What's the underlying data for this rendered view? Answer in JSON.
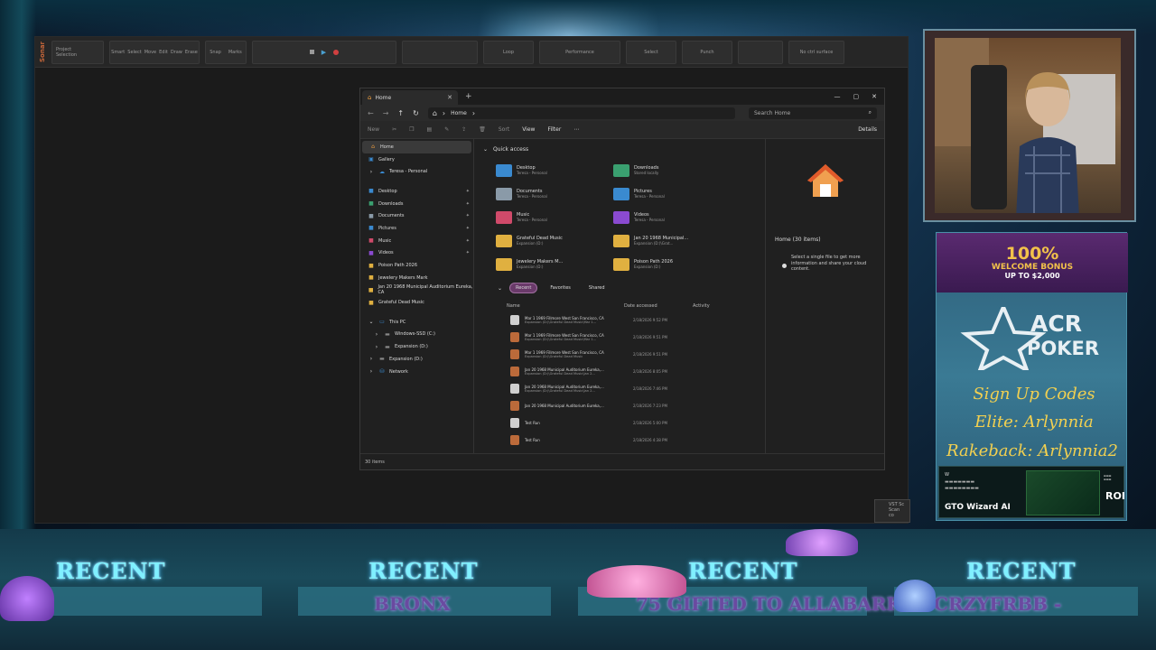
{
  "sonar": {
    "logo": "Sonar",
    "project_label": "Project",
    "selection_label": "Selection",
    "tools": [
      "Smart",
      "Select",
      "Move",
      "Edit",
      "Draw",
      "Erase"
    ],
    "snap_label": "Snap",
    "marks_label": "Marks",
    "loop_label": "Loop",
    "performance_label": "Performance",
    "select_label": "Select",
    "punch_label": "Punch",
    "surface_label": "No ctrl surface"
  },
  "explorer": {
    "tab_title": "Home",
    "breadcrumb": "Home",
    "search_placeholder": "Search Home",
    "cmd": {
      "new": "New",
      "sort": "Sort",
      "view": "View",
      "filter": "Filter",
      "details": "Details"
    },
    "nav": {
      "top": [
        {
          "label": "Home",
          "icon": "home-icon"
        },
        {
          "label": "Gallery",
          "icon": "gallery-icon"
        },
        {
          "label": "Teresa - Personal",
          "icon": "cloud-icon"
        }
      ],
      "pinned": [
        {
          "label": "Desktop",
          "color": "#3a8ad0"
        },
        {
          "label": "Downloads",
          "color": "#3aa070"
        },
        {
          "label": "Documents",
          "color": "#8a9aa8"
        },
        {
          "label": "Pictures",
          "color": "#3a8ad0"
        },
        {
          "label": "Music",
          "color": "#d04a6a"
        },
        {
          "label": "Videos",
          "color": "#8a4ad0"
        },
        {
          "label": "Poison Path 2026",
          "color": "#e0b040"
        },
        {
          "label": "Jewelery Makers Mark",
          "color": "#e0b040"
        },
        {
          "label": "Jan 20 1968 Municipal Auditorium Eureka, CA",
          "color": "#e0b040"
        },
        {
          "label": "Grateful Dead Music",
          "color": "#e0b040"
        }
      ],
      "pc": [
        {
          "label": "This PC",
          "icon": "pc-icon"
        },
        {
          "label": "Windows-SSD (C:)",
          "icon": "drive-icon"
        },
        {
          "label": "Expansion (D:)",
          "icon": "drive-icon"
        },
        {
          "label": "Expansion (D:)",
          "icon": "drive-icon"
        },
        {
          "label": "Network",
          "icon": "network-icon"
        }
      ]
    },
    "quick_access_title": "Quick access",
    "quick_access": [
      {
        "name": "Desktop",
        "sub": "Teresa - Personal",
        "color": "#3a8ad0"
      },
      {
        "name": "Downloads",
        "sub": "Stored locally",
        "color": "#3aa070"
      },
      {
        "name": "Documents",
        "sub": "Teresa - Personal",
        "color": "#8a9aa8"
      },
      {
        "name": "Pictures",
        "sub": "Teresa - Personal",
        "color": "#3a8ad0"
      },
      {
        "name": "Music",
        "sub": "Teresa - Personal",
        "color": "#d04a6a"
      },
      {
        "name": "Videos",
        "sub": "Teresa - Personal",
        "color": "#8a4ad0"
      },
      {
        "name": "Grateful Dead Music",
        "sub": "Expansion (D:)",
        "color": "#e0b040"
      },
      {
        "name": "Jan 20 1968 Municipal...",
        "sub": "Expansion (D:)\\Grat...",
        "color": "#e0b040"
      },
      {
        "name": "Jewelery Makers M...",
        "sub": "Expansion (D:)",
        "color": "#e0b040"
      },
      {
        "name": "Poison Path 2026",
        "sub": "Expansion (D:)",
        "color": "#e0b040"
      }
    ],
    "filters": [
      "Recent",
      "Favorites",
      "Shared"
    ],
    "columns": [
      "Name",
      "Date accessed",
      "Activity"
    ],
    "rows": [
      {
        "name": "Mar 1 1969 Fillmore West San Francisco, CA",
        "path": "Expansion (D:)\\Grateful Dead Music\\Mar 1...",
        "date": "2/18/2026 9:52 PM",
        "kind": "d"
      },
      {
        "name": "Mar 1 1969 Fillmore West San Francisco, CA",
        "path": "Expansion (D:)\\Grateful Dead Music\\Mar 1...",
        "date": "2/18/2026 9:51 PM",
        "kind": "a"
      },
      {
        "name": "Mar 1 1969 Fillmore West San Francisco, CA",
        "path": "Expansion (D:)\\Grateful Dead Music",
        "date": "2/18/2026 9:51 PM",
        "kind": "a"
      },
      {
        "name": "Jan 20 1968 Municipal Auditorium Eureka,...",
        "path": "Expansion (D:)\\Grateful Dead Music\\Jan 2...",
        "date": "2/18/2026 8:05 PM",
        "kind": "a"
      },
      {
        "name": "Jan 20 1968 Municipal Auditorium Eureka,...",
        "path": "Expansion (D:)\\Grateful Dead Music\\Jan 2...",
        "date": "2/18/2026 7:46 PM",
        "kind": "d"
      },
      {
        "name": "Jan 20 1968 Municipal Auditorium Eureka,...",
        "path": "",
        "date": "2/18/2026 7:23 PM",
        "kind": "a"
      },
      {
        "name": "Test Run",
        "path": "",
        "date": "2/18/2026 5:00 PM",
        "kind": "d"
      },
      {
        "name": "Test Run",
        "path": "",
        "date": "2/18/2026 4:38 PM",
        "kind": "a"
      }
    ],
    "detail_title": "Home (30 items)",
    "detail_text": "Select a single file to get more information and share your cloud content.",
    "status": "30 items"
  },
  "vst": {
    "title": "VST Sc",
    "line": "Scan co"
  },
  "ad": {
    "bonus_line1": "100%",
    "bonus_line2": "WELCOME BONUS",
    "bonus_line3": "UP TO $2,000",
    "brand1": "ACR",
    "brand2": "POKER",
    "codes_title": "Sign Up Codes",
    "elite": "Elite: Arlynnia",
    "rakeback": "Rakeback: Arlynnia2",
    "gto_name": "GTO Wizard AI",
    "roi": "ROI"
  },
  "banner": {
    "recent_label": "RECENT",
    "items": [
      "",
      "BRONX",
      "75 GIFTED TO ALLABARK7",
      "CRZYFRBB -"
    ]
  }
}
